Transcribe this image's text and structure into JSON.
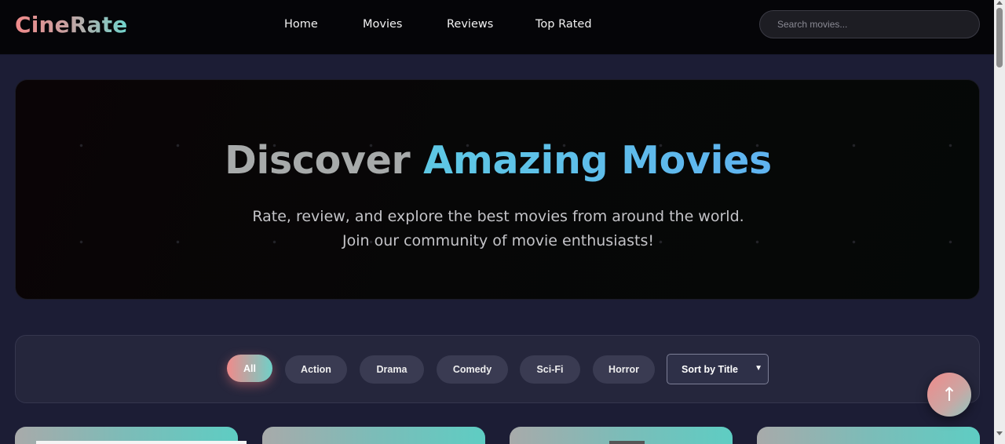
{
  "brand": {
    "name": "CineRate"
  },
  "nav": {
    "items": [
      {
        "label": "Home"
      },
      {
        "label": "Movies"
      },
      {
        "label": "Reviews"
      },
      {
        "label": "Top Rated"
      }
    ]
  },
  "search": {
    "placeholder": "Search movies..."
  },
  "hero": {
    "title_part1": "Discover ",
    "title_part2": "Amazing Movies",
    "subtitle_line1": "Rate, review, and explore the best movies from around the world.",
    "subtitle_line2": "Join our community of movie enthusiasts!"
  },
  "filters": {
    "genres": [
      {
        "label": "All",
        "active": true
      },
      {
        "label": "Action",
        "active": false
      },
      {
        "label": "Drama",
        "active": false
      },
      {
        "label": "Comedy",
        "active": false
      },
      {
        "label": "Sci-Fi",
        "active": false
      },
      {
        "label": "Horror",
        "active": false
      }
    ],
    "sort": {
      "selected": "Sort by Title"
    }
  },
  "back_to_top": {
    "icon": "arrow-up-icon",
    "glyph": "↑"
  },
  "colors": {
    "accent_pink": "#f08a8a",
    "accent_teal": "#6fd4cc",
    "accent_blue": "#5fb3f0",
    "page_bg": "#1c1d35"
  }
}
